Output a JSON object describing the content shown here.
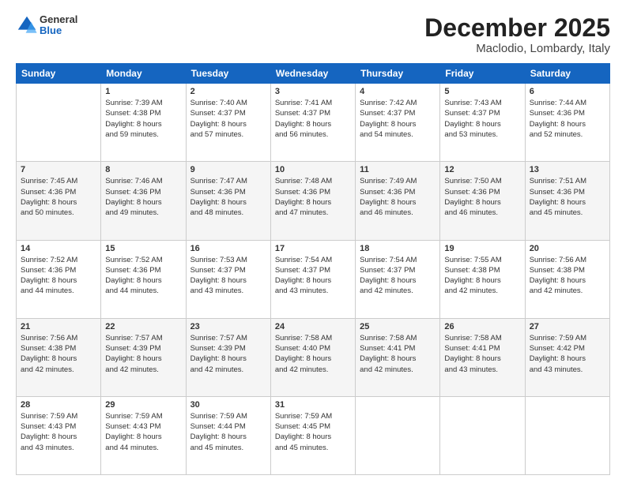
{
  "logo": {
    "general": "General",
    "blue": "Blue"
  },
  "title": "December 2025",
  "location": "Maclodio, Lombardy, Italy",
  "days_header": [
    "Sunday",
    "Monday",
    "Tuesday",
    "Wednesday",
    "Thursday",
    "Friday",
    "Saturday"
  ],
  "weeks": [
    [
      {
        "day": "",
        "info": ""
      },
      {
        "day": "1",
        "info": "Sunrise: 7:39 AM\nSunset: 4:38 PM\nDaylight: 8 hours\nand 59 minutes."
      },
      {
        "day": "2",
        "info": "Sunrise: 7:40 AM\nSunset: 4:37 PM\nDaylight: 8 hours\nand 57 minutes."
      },
      {
        "day": "3",
        "info": "Sunrise: 7:41 AM\nSunset: 4:37 PM\nDaylight: 8 hours\nand 56 minutes."
      },
      {
        "day": "4",
        "info": "Sunrise: 7:42 AM\nSunset: 4:37 PM\nDaylight: 8 hours\nand 54 minutes."
      },
      {
        "day": "5",
        "info": "Sunrise: 7:43 AM\nSunset: 4:37 PM\nDaylight: 8 hours\nand 53 minutes."
      },
      {
        "day": "6",
        "info": "Sunrise: 7:44 AM\nSunset: 4:36 PM\nDaylight: 8 hours\nand 52 minutes."
      }
    ],
    [
      {
        "day": "7",
        "info": "Sunrise: 7:45 AM\nSunset: 4:36 PM\nDaylight: 8 hours\nand 50 minutes."
      },
      {
        "day": "8",
        "info": "Sunrise: 7:46 AM\nSunset: 4:36 PM\nDaylight: 8 hours\nand 49 minutes."
      },
      {
        "day": "9",
        "info": "Sunrise: 7:47 AM\nSunset: 4:36 PM\nDaylight: 8 hours\nand 48 minutes."
      },
      {
        "day": "10",
        "info": "Sunrise: 7:48 AM\nSunset: 4:36 PM\nDaylight: 8 hours\nand 47 minutes."
      },
      {
        "day": "11",
        "info": "Sunrise: 7:49 AM\nSunset: 4:36 PM\nDaylight: 8 hours\nand 46 minutes."
      },
      {
        "day": "12",
        "info": "Sunrise: 7:50 AM\nSunset: 4:36 PM\nDaylight: 8 hours\nand 46 minutes."
      },
      {
        "day": "13",
        "info": "Sunrise: 7:51 AM\nSunset: 4:36 PM\nDaylight: 8 hours\nand 45 minutes."
      }
    ],
    [
      {
        "day": "14",
        "info": "Sunrise: 7:52 AM\nSunset: 4:36 PM\nDaylight: 8 hours\nand 44 minutes."
      },
      {
        "day": "15",
        "info": "Sunrise: 7:52 AM\nSunset: 4:36 PM\nDaylight: 8 hours\nand 44 minutes."
      },
      {
        "day": "16",
        "info": "Sunrise: 7:53 AM\nSunset: 4:37 PM\nDaylight: 8 hours\nand 43 minutes."
      },
      {
        "day": "17",
        "info": "Sunrise: 7:54 AM\nSunset: 4:37 PM\nDaylight: 8 hours\nand 43 minutes."
      },
      {
        "day": "18",
        "info": "Sunrise: 7:54 AM\nSunset: 4:37 PM\nDaylight: 8 hours\nand 42 minutes."
      },
      {
        "day": "19",
        "info": "Sunrise: 7:55 AM\nSunset: 4:38 PM\nDaylight: 8 hours\nand 42 minutes."
      },
      {
        "day": "20",
        "info": "Sunrise: 7:56 AM\nSunset: 4:38 PM\nDaylight: 8 hours\nand 42 minutes."
      }
    ],
    [
      {
        "day": "21",
        "info": "Sunrise: 7:56 AM\nSunset: 4:38 PM\nDaylight: 8 hours\nand 42 minutes."
      },
      {
        "day": "22",
        "info": "Sunrise: 7:57 AM\nSunset: 4:39 PM\nDaylight: 8 hours\nand 42 minutes."
      },
      {
        "day": "23",
        "info": "Sunrise: 7:57 AM\nSunset: 4:39 PM\nDaylight: 8 hours\nand 42 minutes."
      },
      {
        "day": "24",
        "info": "Sunrise: 7:58 AM\nSunset: 4:40 PM\nDaylight: 8 hours\nand 42 minutes."
      },
      {
        "day": "25",
        "info": "Sunrise: 7:58 AM\nSunset: 4:41 PM\nDaylight: 8 hours\nand 42 minutes."
      },
      {
        "day": "26",
        "info": "Sunrise: 7:58 AM\nSunset: 4:41 PM\nDaylight: 8 hours\nand 43 minutes."
      },
      {
        "day": "27",
        "info": "Sunrise: 7:59 AM\nSunset: 4:42 PM\nDaylight: 8 hours\nand 43 minutes."
      }
    ],
    [
      {
        "day": "28",
        "info": "Sunrise: 7:59 AM\nSunset: 4:43 PM\nDaylight: 8 hours\nand 43 minutes."
      },
      {
        "day": "29",
        "info": "Sunrise: 7:59 AM\nSunset: 4:43 PM\nDaylight: 8 hours\nand 44 minutes."
      },
      {
        "day": "30",
        "info": "Sunrise: 7:59 AM\nSunset: 4:44 PM\nDaylight: 8 hours\nand 45 minutes."
      },
      {
        "day": "31",
        "info": "Sunrise: 7:59 AM\nSunset: 4:45 PM\nDaylight: 8 hours\nand 45 minutes."
      },
      {
        "day": "",
        "info": ""
      },
      {
        "day": "",
        "info": ""
      },
      {
        "day": "",
        "info": ""
      }
    ]
  ]
}
